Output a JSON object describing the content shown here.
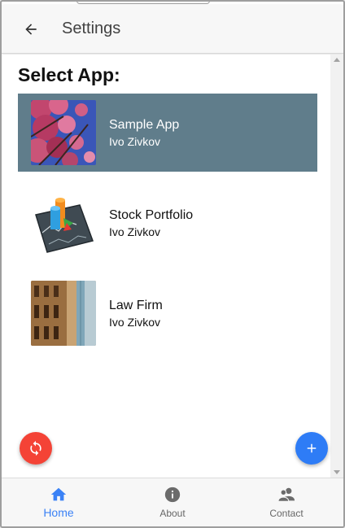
{
  "appbar": {
    "title": "Settings"
  },
  "main": {
    "section_title": "Select App:",
    "apps": [
      {
        "name": "Sample App",
        "author": "Ivo Zivkov",
        "selected": true
      },
      {
        "name": "Stock Portfolio",
        "author": "Ivo Zivkov",
        "selected": false
      },
      {
        "name": "Law Firm",
        "author": "Ivo Zivkov",
        "selected": false
      }
    ]
  },
  "bottom_nav": {
    "items": [
      {
        "label": "Home",
        "icon": "home-icon",
        "active": true
      },
      {
        "label": "About",
        "icon": "info-icon",
        "active": false
      },
      {
        "label": "Contact",
        "icon": "contacts-icon",
        "active": false
      }
    ]
  },
  "colors": {
    "accent": "#3b82f6",
    "selected_row": "#607d8b",
    "sync_fab": "#f44336",
    "add_fab": "#2e7cf6"
  }
}
